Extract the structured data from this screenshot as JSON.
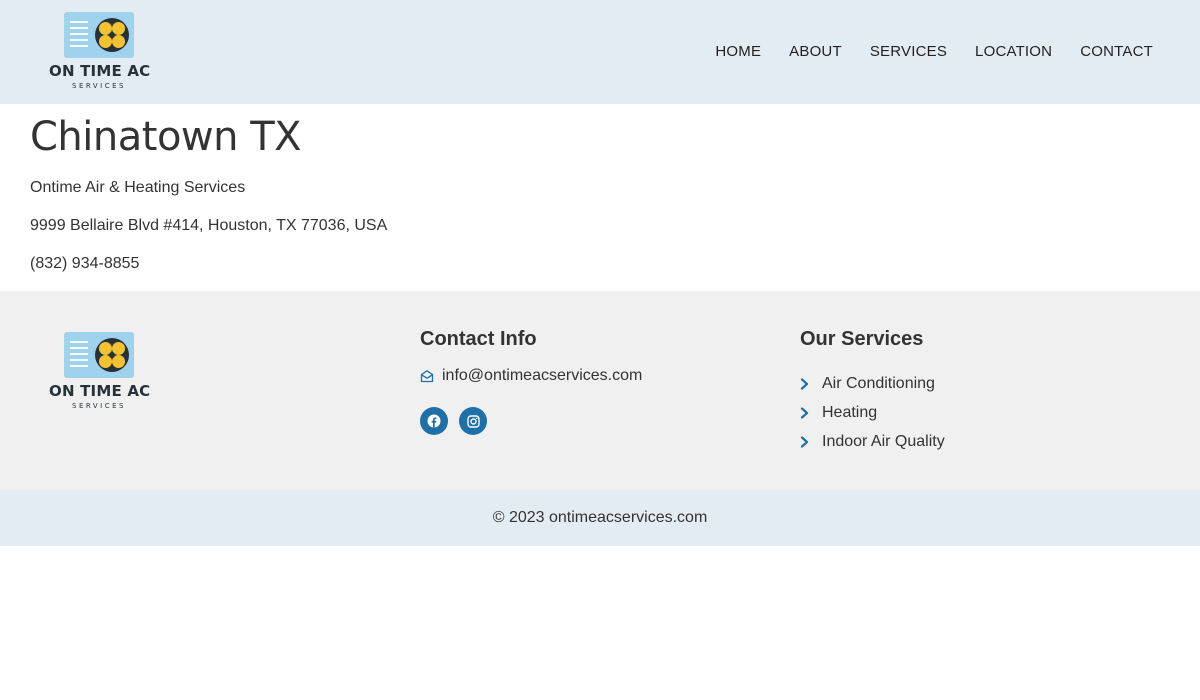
{
  "header": {
    "logo": {
      "brand": "ON TIME AC",
      "sub": "SERVICES"
    },
    "nav": [
      "HOME",
      "ABOUT",
      "SERVICES",
      "LOCATION",
      "CONTACT"
    ]
  },
  "main": {
    "title": "Chinatown TX",
    "company": "Ontime Air & Heating Services",
    "address": "9999 Bellaire Blvd #414, Houston, TX 77036, USA",
    "phone": "(832) 934-8855"
  },
  "footer": {
    "logo": {
      "brand": "ON TIME AC",
      "sub": "SERVICES"
    },
    "contact": {
      "heading": "Contact Info",
      "email": "info@ontimeacservices.com",
      "socials": [
        "facebook-icon",
        "instagram-icon"
      ]
    },
    "services": {
      "heading": "Our Services",
      "items": [
        "Air Conditioning",
        "Heating",
        "Indoor Air Quality"
      ]
    },
    "copyright": "© 2023 ontimeacservices.com"
  },
  "colors": {
    "header_bg": "#e4ecf3",
    "footer_bg": "#f0f0f0",
    "accent": "#1f6fa8",
    "logo_blue": "#9fd2ec",
    "logo_yellow": "#f2c230"
  }
}
